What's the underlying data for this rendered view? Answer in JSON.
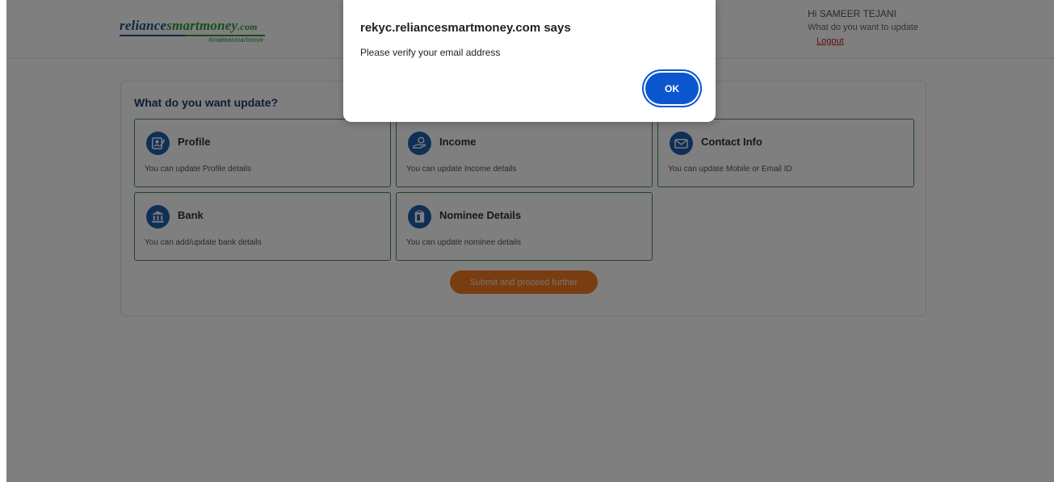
{
  "logo": {
    "brand_part1": "reliance",
    "brand_part2": "smartmoney",
    "brand_part3": ".com",
    "tagline": "#makeasmartmove"
  },
  "user": {
    "greeting": "Hi SAMEER TEJANI",
    "subtitle": "What do you want to update",
    "logout_label": "Logout"
  },
  "panel": {
    "title": "What do you want update?",
    "cards": [
      {
        "title": "Profile",
        "description": "You can update Profile details",
        "icon": "profile-icon"
      },
      {
        "title": "Income",
        "description": "You can update Income details",
        "icon": "income-icon"
      },
      {
        "title": "Contact Info",
        "description": "You can update Mobile or Email ID",
        "icon": "contact-info-icon"
      },
      {
        "title": "Bank",
        "description": "You can add/update bank details",
        "icon": "bank-icon"
      },
      {
        "title": "Nominee Details",
        "description": "You can update nominee details",
        "icon": "nominee-icon"
      }
    ],
    "submit_label": "Submit and proceed further"
  },
  "dialog": {
    "title": "rekyc.reliancesmartmoney.com says",
    "message": "Please verify your email address",
    "ok_label": "OK"
  },
  "colors": {
    "brand_blue": "#1b4f8f",
    "brand_green": "#2e9a3a",
    "submit_orange": "#f07a22",
    "card_border": "#3c8a5a",
    "icon_blue": "#1e5fae",
    "dialog_ok": "#0b57d0",
    "logout_red": "#c81a1a"
  }
}
